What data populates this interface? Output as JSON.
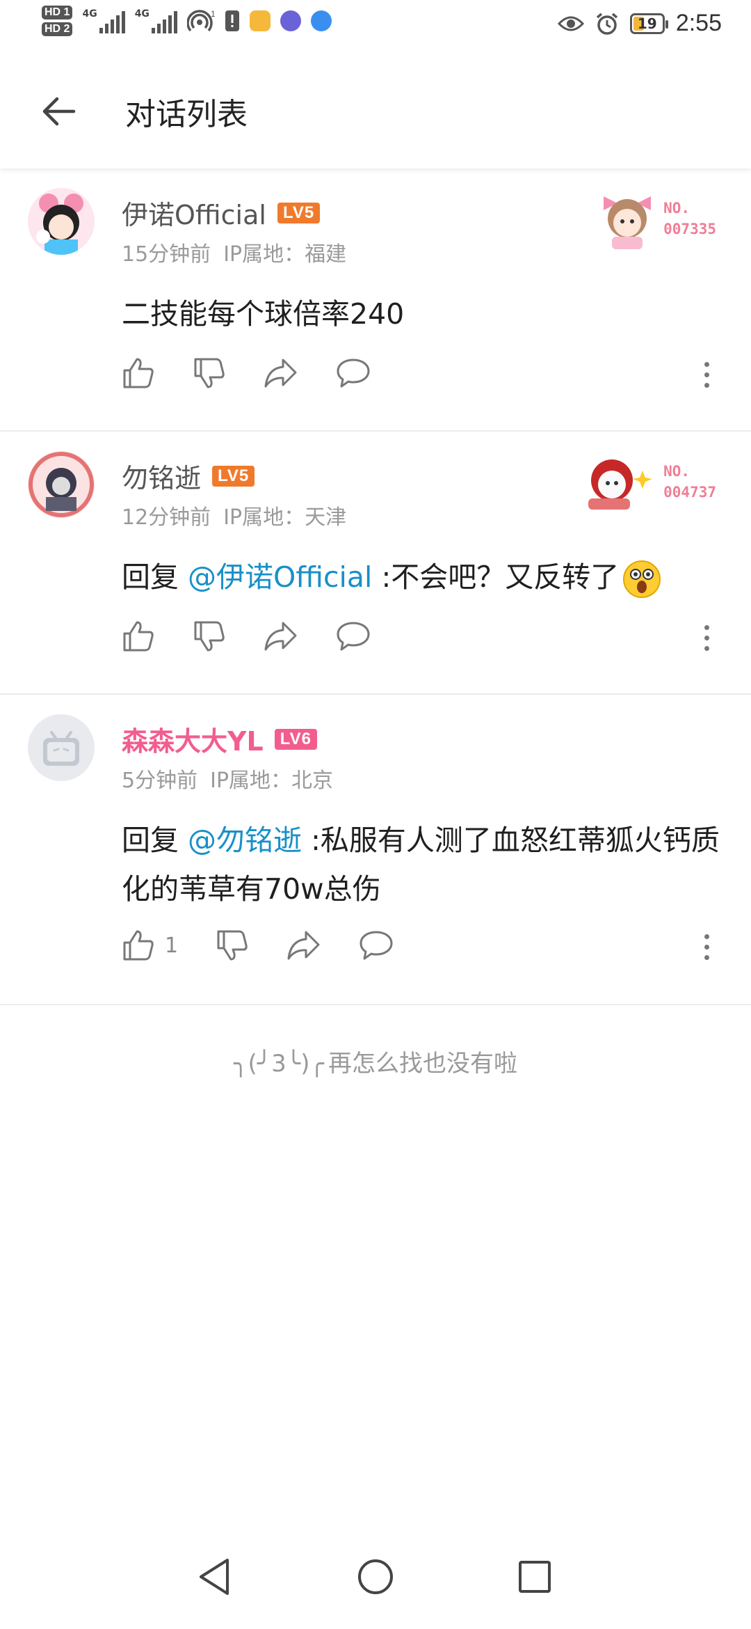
{
  "status_bar": {
    "sim1": "HD 1",
    "sim2": "HD 2",
    "net1": "4G",
    "net2": "4G",
    "hotspot_count": "1",
    "battery": "19",
    "time": "2:55"
  },
  "header": {
    "title": "对话列表"
  },
  "comments": [
    {
      "user": "伊诺Official",
      "level": "LV5",
      "level_color": "#f07a2b",
      "time": "15分钟前",
      "ip": "IP属地：福建",
      "badge_no": [
        "NO.",
        "007335"
      ],
      "text": "二技能每个球倍率240",
      "likes": ""
    },
    {
      "user": "勿铭逝",
      "level": "LV5",
      "level_color": "#f07a2b",
      "time": "12分钟前",
      "ip": "IP属地：天津",
      "badge_no": [
        "NO.",
        "004737"
      ],
      "reply_prefix": "回复 ",
      "mention": "@伊诺Official",
      "text": " :不会吧？又反转了",
      "emoji": "shocked-face",
      "likes": ""
    },
    {
      "user": "森森大大YL",
      "level": "LV6",
      "level_color": "#f25d8e",
      "time": "5分钟前",
      "ip": "IP属地：北京",
      "reply_prefix": "回复 ",
      "mention": "@勿铭逝",
      "text": " :私服有人测了血怒红蒂狐火钙质化的苇草有70w总伤",
      "likes": "1"
    }
  ],
  "footer": {
    "face": "╮(╯3╰)╭",
    "end_text": "再怎么找也没有啦"
  },
  "colors": {
    "mention": "#1890c8",
    "vip_name": "#f25d8e",
    "badge_text": "#f07e96"
  }
}
